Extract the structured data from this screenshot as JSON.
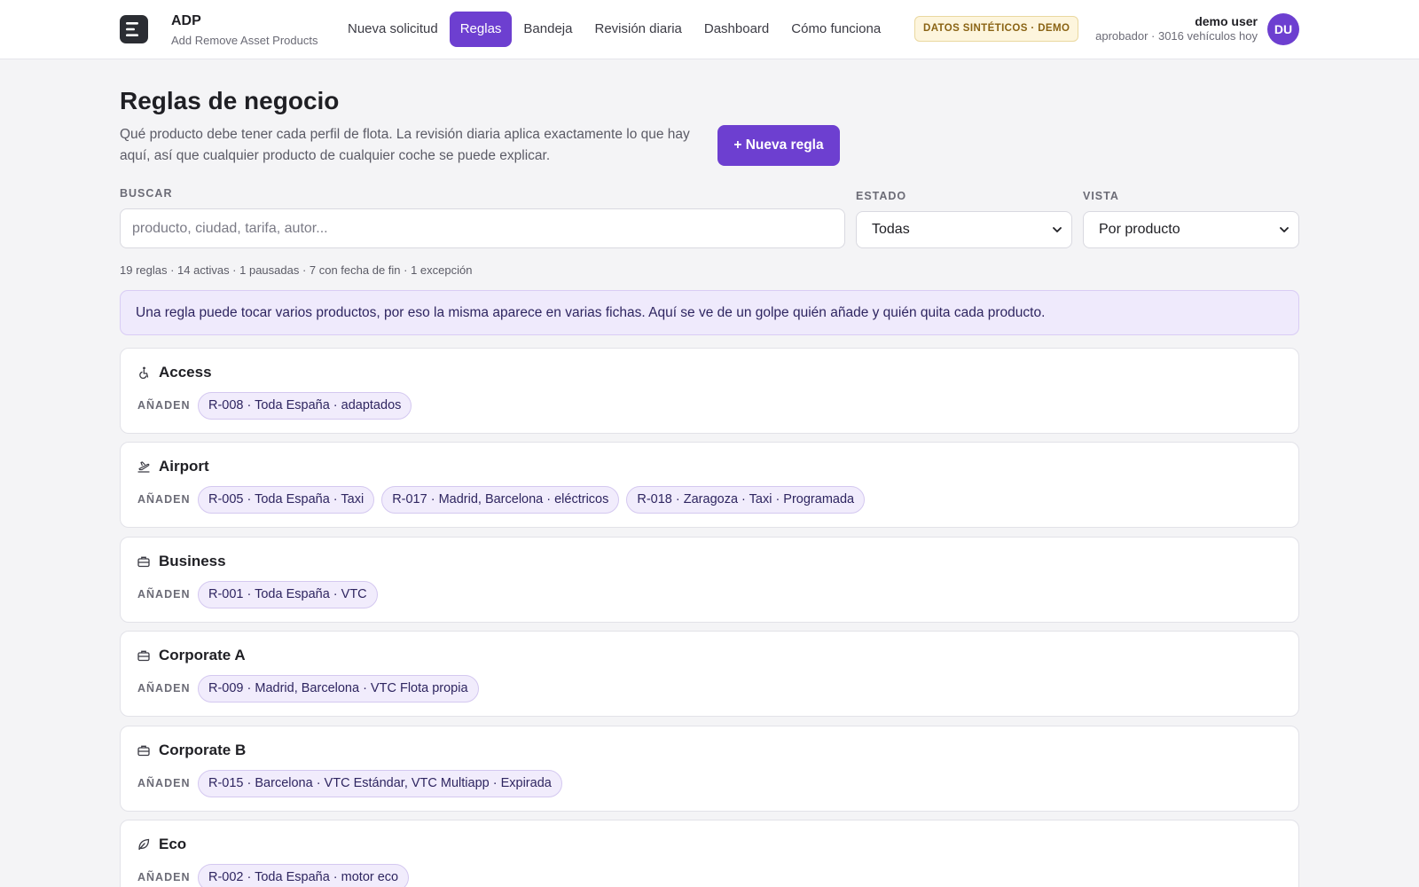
{
  "app": {
    "name": "ADP",
    "subtitle": "Add Remove Asset Products",
    "nav": [
      {
        "label": "Nueva solicitud",
        "active": false
      },
      {
        "label": "Reglas",
        "active": true
      },
      {
        "label": "Bandeja",
        "active": false
      },
      {
        "label": "Revisión diaria",
        "active": false
      },
      {
        "label": "Dashboard",
        "active": false
      },
      {
        "label": "Cómo funciona",
        "active": false
      }
    ],
    "badge": "DATOS SINTÉTICOS · DEMO",
    "user": {
      "name": "demo user",
      "role": "aprobador · 3016 vehículos hoy",
      "initials": "DU"
    },
    "accent_color": "#6d3fd0"
  },
  "page": {
    "title": "Reglas de negocio",
    "description": "Qué producto debe tener cada perfil de flota. La revisión diaria aplica exactamente lo que hay aquí, así que cualquier producto de cualquier coche se puede explicar.",
    "new_rule_label": "+ Nueva regla"
  },
  "filters": {
    "search_label": "BUSCAR",
    "search_placeholder": "producto, ciudad, tarifa, autor...",
    "search_value": "",
    "status_label": "ESTADO",
    "status_value": "Todas",
    "view_label": "VISTA",
    "view_value": "Por producto"
  },
  "summary": "19 reglas · 14 activas · 1 pausadas · 7 con fecha de fin · 1 excepción",
  "info_banner": "Una regla puede tocar varios productos, por eso la misma aparece en varias fichas. Aquí se ve de un golpe quién añade y quién quita cada producto.",
  "products": [
    {
      "name": "Access",
      "icon": "wheelchair-icon",
      "label": "AÑADEN",
      "rules": [
        "R-008 · Toda España · adaptados"
      ]
    },
    {
      "name": "Airport",
      "icon": "plane-icon",
      "label": "AÑADEN",
      "rules": [
        "R-005 · Toda España · Taxi",
        "R-017 · Madrid, Barcelona · eléctricos",
        "R-018 · Zaragoza · Taxi · Programada"
      ]
    },
    {
      "name": "Business",
      "icon": "briefcase-icon",
      "label": "AÑADEN",
      "rules": [
        "R-001 · Toda España · VTC"
      ]
    },
    {
      "name": "Corporate A",
      "icon": "briefcase-icon",
      "label": "AÑADEN",
      "rules": [
        "R-009 · Madrid, Barcelona · VTC Flota propia"
      ]
    },
    {
      "name": "Corporate B",
      "icon": "briefcase-icon",
      "label": "AÑADEN",
      "rules": [
        "R-015 · Barcelona · VTC Estándar, VTC Multiapp · Expirada"
      ]
    },
    {
      "name": "Eco",
      "icon": "leaf-icon",
      "label": "AÑADEN",
      "rules": [
        "R-002 · Toda España · motor eco"
      ]
    }
  ]
}
